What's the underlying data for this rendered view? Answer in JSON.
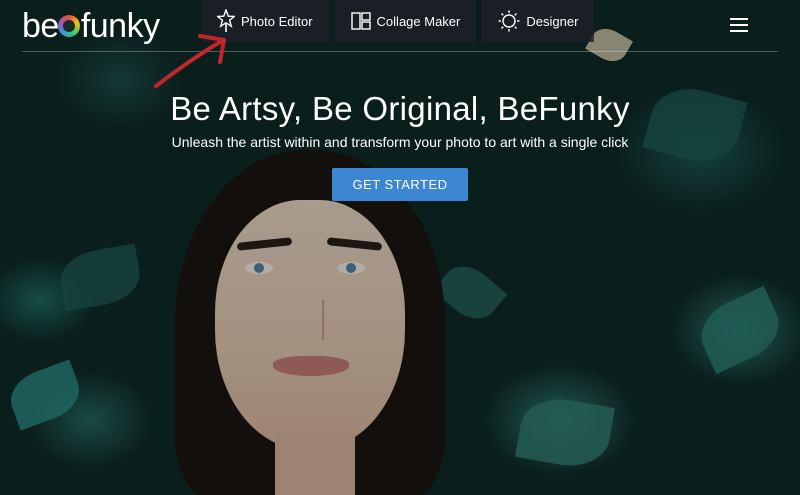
{
  "logo": {
    "text_before": "be",
    "text_after": "funky"
  },
  "nav": [
    {
      "label": "Photo Editor",
      "icon": "star-wand-icon"
    },
    {
      "label": "Collage Maker",
      "icon": "collage-grid-icon"
    },
    {
      "label": "Designer",
      "icon": "designer-sun-icon"
    }
  ],
  "menu_icon": "hamburger-menu-icon",
  "hero": {
    "headline": "Be Artsy, Be Original, BeFunky",
    "subheadline": "Unleash the artist within and transform your photo to art with a single click",
    "cta": "GET STARTED"
  },
  "colors": {
    "cta": "#3d86d4",
    "nav_bg": "#1e2028",
    "annotation_arrow": "#c0262c"
  }
}
